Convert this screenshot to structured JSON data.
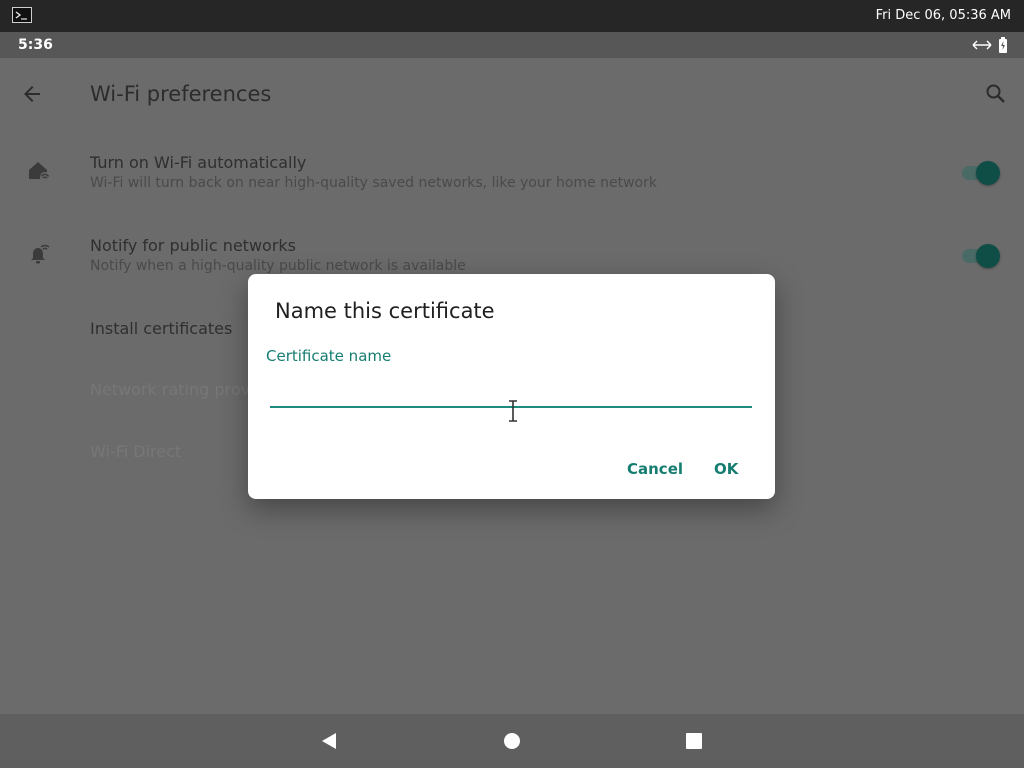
{
  "host": {
    "clock": "Fri Dec 06, 05:36 AM",
    "terminal_icon": "terminal-icon"
  },
  "status_bar": {
    "time": "5:36",
    "icons": [
      "data-transfer-icon",
      "battery-icon"
    ]
  },
  "app_bar": {
    "title": "Wi-Fi preferences",
    "back_icon": "arrow-back-icon",
    "search_icon": "search-icon"
  },
  "preferences": [
    {
      "title": "Turn on Wi-Fi automatically",
      "summary": "Wi-Fi will turn back on near high-quality saved networks, like your home network",
      "icon": "home-wifi-icon",
      "toggle": true
    },
    {
      "title": "Notify for public networks",
      "summary": "Notify when a high-quality public network is available",
      "icon": "notification-wifi-icon",
      "toggle": true
    },
    {
      "title": "Install certificates"
    },
    {
      "title": "Network rating prov"
    },
    {
      "title": "Wi-Fi Direct"
    }
  ],
  "dialog": {
    "title": "Name this certificate",
    "field_label": "Certificate name",
    "field_value": "",
    "cancel_label": "Cancel",
    "ok_label": "OK"
  },
  "colors": {
    "accent": "#167d71",
    "scrim": "#6b6b6b",
    "toggle_on": "#0f4e47"
  }
}
